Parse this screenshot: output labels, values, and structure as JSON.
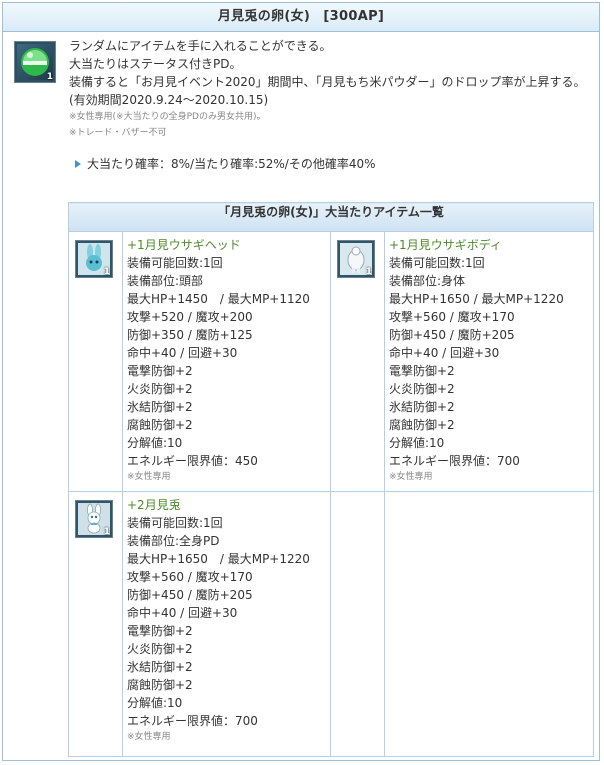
{
  "header": {
    "title": "月見兎の卵(女)　[300AP]"
  },
  "item": {
    "qty": "1"
  },
  "description": {
    "lines": [
      "ランダムにアイテムを手に入れることができる。",
      "大当たりはステータス付きPD。",
      "装備すると「お月見イベント2020」期間中、「月見もち米パウダー」のドロップ率が上昇する。",
      "(有効期間2020.9.24～2020.10.15)"
    ],
    "notes": [
      "※女性専用(※大当たりの全身PDのみ男女共用)。",
      "※トレード・バザー不可"
    ]
  },
  "rates": "大当たり確率：8%/当たり確率:52%/その他確率40%",
  "table": {
    "title": "「月見兎の卵(女)」大当たりアイテム一覧",
    "items": [
      {
        "qty": "1",
        "name": "+1月見ウサギヘッド",
        "lines": [
          "装備可能回数:1回",
          "装備部位:頭部",
          "最大HP+1450　/ 最大MP+1120",
          "攻撃+520 / 魔攻+200",
          "防御+350 / 魔防+125",
          "命中+40 / 回避+30",
          "電撃防御+2",
          "火炎防御+2",
          "氷結防御+2",
          "腐蝕防御+2",
          "分解値:10",
          "エネルギー限界値：450"
        ],
        "note": "※女性専用"
      },
      {
        "qty": "1",
        "name": "+1月見ウサギボディ",
        "lines": [
          "装備可能回数:1回",
          "装備部位:身体",
          "最大HP+1650 / 最大MP+1220",
          "攻撃+560 / 魔攻+170",
          "防御+450 / 魔防+205",
          "命中+40 / 回避+30",
          "電撃防御+2",
          "火炎防御+2",
          "氷結防御+2",
          "腐蝕防御+2",
          "分解値:10",
          "エネルギー限界値：700"
        ],
        "note": "※女性専用"
      },
      {
        "qty": "1",
        "name": "+2月見兎",
        "lines": [
          "装備可能回数:1回",
          "装備部位:全身PD",
          "最大HP+1650　/ 最大MP+1220",
          "攻撃+560 / 魔攻+170",
          "防御+450 / 魔防+205",
          "命中+40 / 回避+30",
          "電撃防御+2",
          "火炎防御+2",
          "氷結防御+2",
          "腐蝕防御+2",
          "分解値:10",
          "エネルギー限界値：700"
        ],
        "note": "※女性専用"
      }
    ]
  }
}
